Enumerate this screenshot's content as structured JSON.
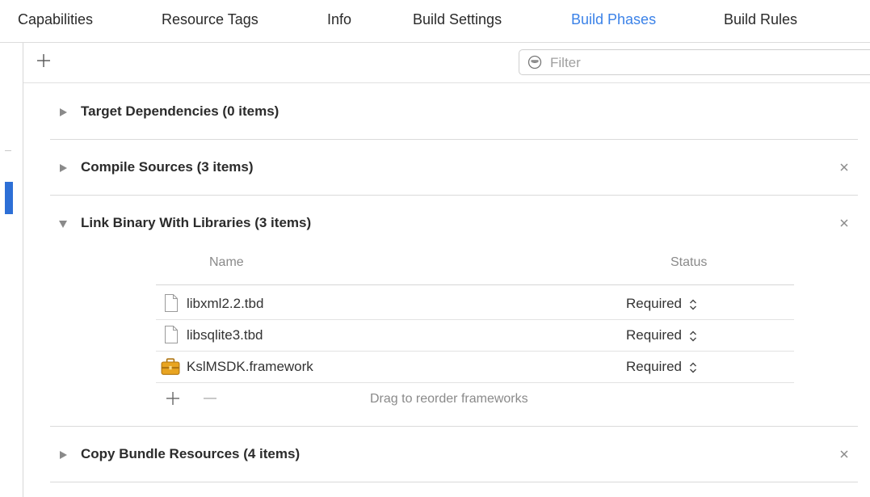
{
  "tabs": [
    {
      "label": "Capabilities"
    },
    {
      "label": "Resource Tags"
    },
    {
      "label": "Info"
    },
    {
      "label": "Build Settings"
    },
    {
      "label": "Build Phases",
      "active": true
    },
    {
      "label": "Build Rules"
    }
  ],
  "toolbar": {
    "filter_placeholder": "Filter",
    "icons": {
      "add": "plus-icon",
      "filter": "filter-icon"
    }
  },
  "phases": [
    {
      "title": "Target Dependencies (0 items)",
      "expanded": false,
      "removable": false
    },
    {
      "title": "Compile Sources (3 items)",
      "expanded": false,
      "removable": true
    },
    {
      "title": "Link Binary With Libraries (3 items)",
      "expanded": true,
      "removable": true
    },
    {
      "title": "Copy Bundle Resources (4 items)",
      "expanded": false,
      "removable": true
    }
  ],
  "libraries": {
    "columns": {
      "name": "Name",
      "status": "Status"
    },
    "rows": [
      {
        "name": "libxml2.2.tbd",
        "status": "Required",
        "icon": "document-icon"
      },
      {
        "name": "libsqlite3.tbd",
        "status": "Required",
        "icon": "document-icon"
      },
      {
        "name": "KslMSDK.framework",
        "status": "Required",
        "icon": "framework-toolbox-icon"
      }
    ],
    "footer_hint": "Drag to reorder frameworks"
  },
  "colors": {
    "accent": "#3b82e8",
    "selection": "#2d6fd6",
    "framework_icon": "#e8a421"
  }
}
